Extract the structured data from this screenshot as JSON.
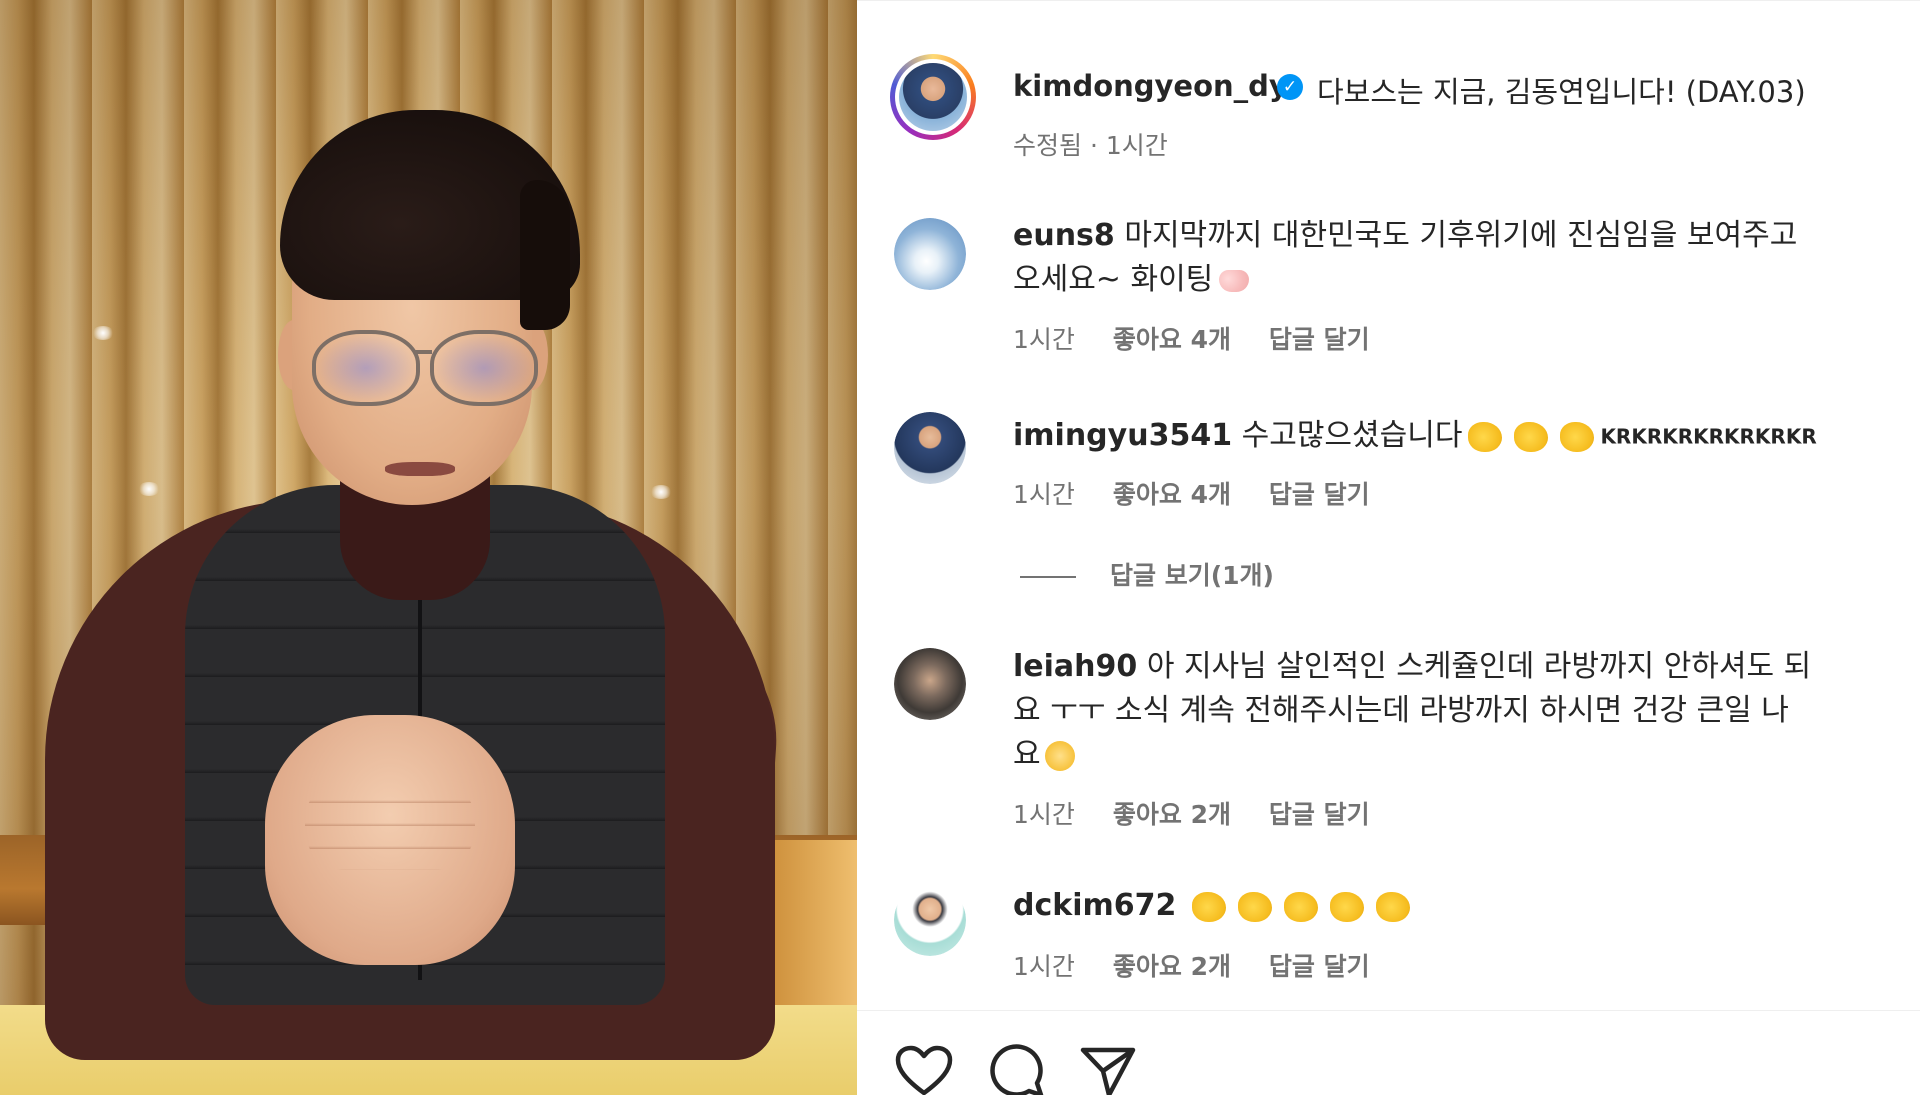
{
  "post": {
    "author": "kimdongyeon_dy",
    "caption": "다보스는 지금, 김동연입니다! (DAY.03)",
    "meta": "수정됨 · 1시간",
    "verified_icon": "verified-badge-icon"
  },
  "comments": [
    {
      "username": "euns8",
      "text_line1": "마지막까지 대한민국도 기후위기에 진심임을 보여주고",
      "text_line2": "오세요~ 화이팅",
      "emoji": "heart-hands-emoji",
      "time": "1시간",
      "likes": "좋아요 4개",
      "reply": "답글 달기"
    },
    {
      "username": "imingyu3541",
      "text_line1": "수고많으셨습니다",
      "emoji": "clapping-hands-emoji x3",
      "suffix": "KRKRKRKRKRKRKR",
      "time": "1시간",
      "likes": "좋아요 4개",
      "reply": "답글 달기",
      "view_replies": "답글 보기(1개)"
    },
    {
      "username": "leiah90",
      "text_line1": "아 지사님 살인적인 스케쥴인데 라방까지 안하셔도 되",
      "text_line2": "요 ㅜㅜ 소식 계속 전해주시는데 라방까지 하시면 건강 큰일 나",
      "text_line3": "요",
      "emoji": "flushed-face-emoji",
      "time": "1시간",
      "likes": "좋아요 2개",
      "reply": "답글 달기"
    },
    {
      "username": "dckim672",
      "emoji": "clapping-hands-emoji x5",
      "time": "1시간",
      "likes": "좋아요 2개",
      "reply": "답글 달기"
    }
  ],
  "actions": {
    "like_icon": "heart-icon",
    "comment_icon": "comment-bubble-icon",
    "share_icon": "paper-plane-icon"
  },
  "colors": {
    "text": "#262626",
    "secondary": "#737373",
    "verified": "#0095f6"
  }
}
